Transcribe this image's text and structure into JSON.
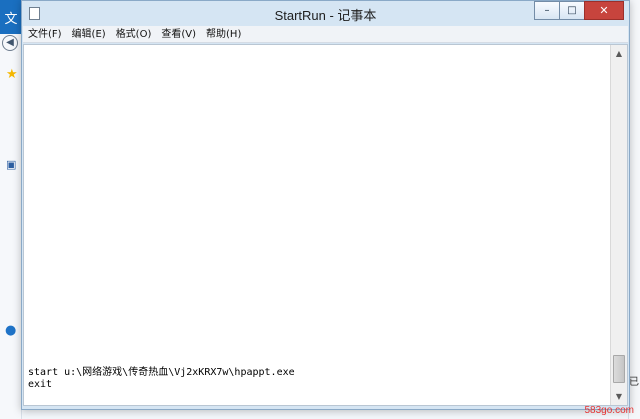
{
  "background": {
    "left_top_char": "文",
    "right_char": "已"
  },
  "window": {
    "title": "StartRun - 记事本",
    "controls": {
      "minimize": "–",
      "maximize": "□",
      "close": "✕"
    }
  },
  "menu": {
    "items": [
      {
        "label": "文件(F)"
      },
      {
        "label": "编辑(E)"
      },
      {
        "label": "格式(O)"
      },
      {
        "label": "查看(V)"
      },
      {
        "label": "帮助(H)"
      }
    ]
  },
  "editor": {
    "lines": [
      "start u:\\网络游戏\\传奇热血\\Vj2xKRX7w\\hpappt.exe",
      "exit"
    ]
  },
  "watermark": {
    "prefix": "583go.",
    "suffix": "com"
  },
  "colors": {
    "accent": "#1a6fc0",
    "close": "#c7443d"
  }
}
